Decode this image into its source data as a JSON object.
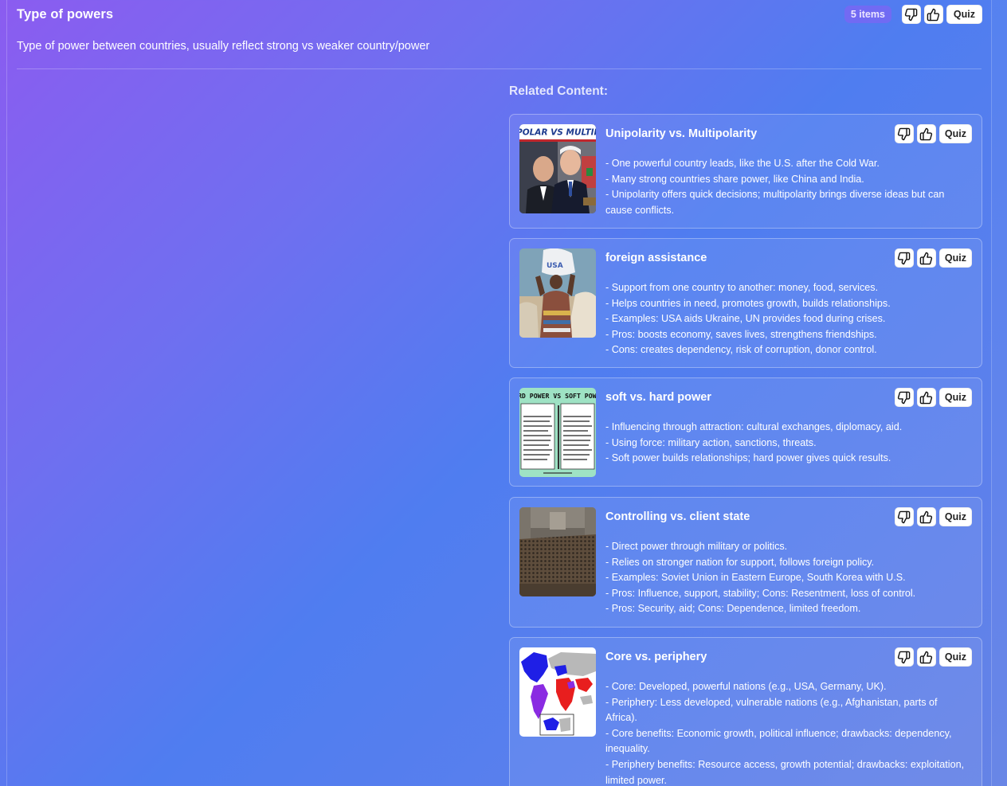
{
  "header": {
    "title": "Type of powers",
    "item_count": "5 items",
    "quiz_label": "Quiz",
    "description": "Type of power between countries, usually reflect strong vs weaker country/power"
  },
  "related": {
    "heading": "Related Content:",
    "cards": [
      {
        "title": "Unipolarity vs. Multipolarity",
        "quiz_label": "Quiz",
        "image_text": "POLAR VS MULTIPO",
        "bullets": [
          "- One powerful country leads, like the U.S. after the Cold War.",
          "- Many strong countries share power, like China and India.",
          "- Unipolarity offers quick decisions; multipolarity brings diverse ideas but can cause conflicts."
        ]
      },
      {
        "title": "foreign assistance",
        "quiz_label": "Quiz",
        "image_text": "USA",
        "bullets": [
          "- Support from one country to another: money, food, services.",
          "- Helps countries in need, promotes growth, builds relationships.",
          "- Examples: USA aids Ukraine, UN provides food during crises.",
          "- Pros: boosts economy, saves lives, strengthens friendships.",
          "- Cons: creates dependency, risk of corruption, donor control."
        ]
      },
      {
        "title": "soft vs. hard power",
        "quiz_label": "Quiz",
        "image_text": "RD POWER VS SOFT POW",
        "bullets": [
          "- Influencing through attraction: cultural exchanges, diplomacy, aid.",
          "- Using force: military action, sanctions, threats.",
          "- Soft power builds relationships; hard power gives quick results."
        ]
      },
      {
        "title": "Controlling vs. client state",
        "quiz_label": "Quiz",
        "bullets": [
          "- Direct power through military or politics.",
          "- Relies on stronger nation for support, follows foreign policy.",
          "- Examples: Soviet Union in Eastern Europe, South Korea with U.S.",
          "- Pros: Influence, support, stability; Cons: Resentment, loss of control.",
          "- Pros: Security, aid; Cons: Dependence, limited freedom."
        ]
      },
      {
        "title": "Core vs. periphery",
        "quiz_label": "Quiz",
        "bullets": [
          "- Core: Developed, powerful nations (e.g., USA, Germany, UK).",
          "- Periphery: Less developed, vulnerable nations (e.g., Afghanistan, parts of Africa).",
          "- Core benefits: Economic growth, political influence; drawbacks: dependency, inequality.",
          "- Periphery benefits: Resource access, growth potential; drawbacks: exploitation, limited power."
        ]
      }
    ]
  }
}
